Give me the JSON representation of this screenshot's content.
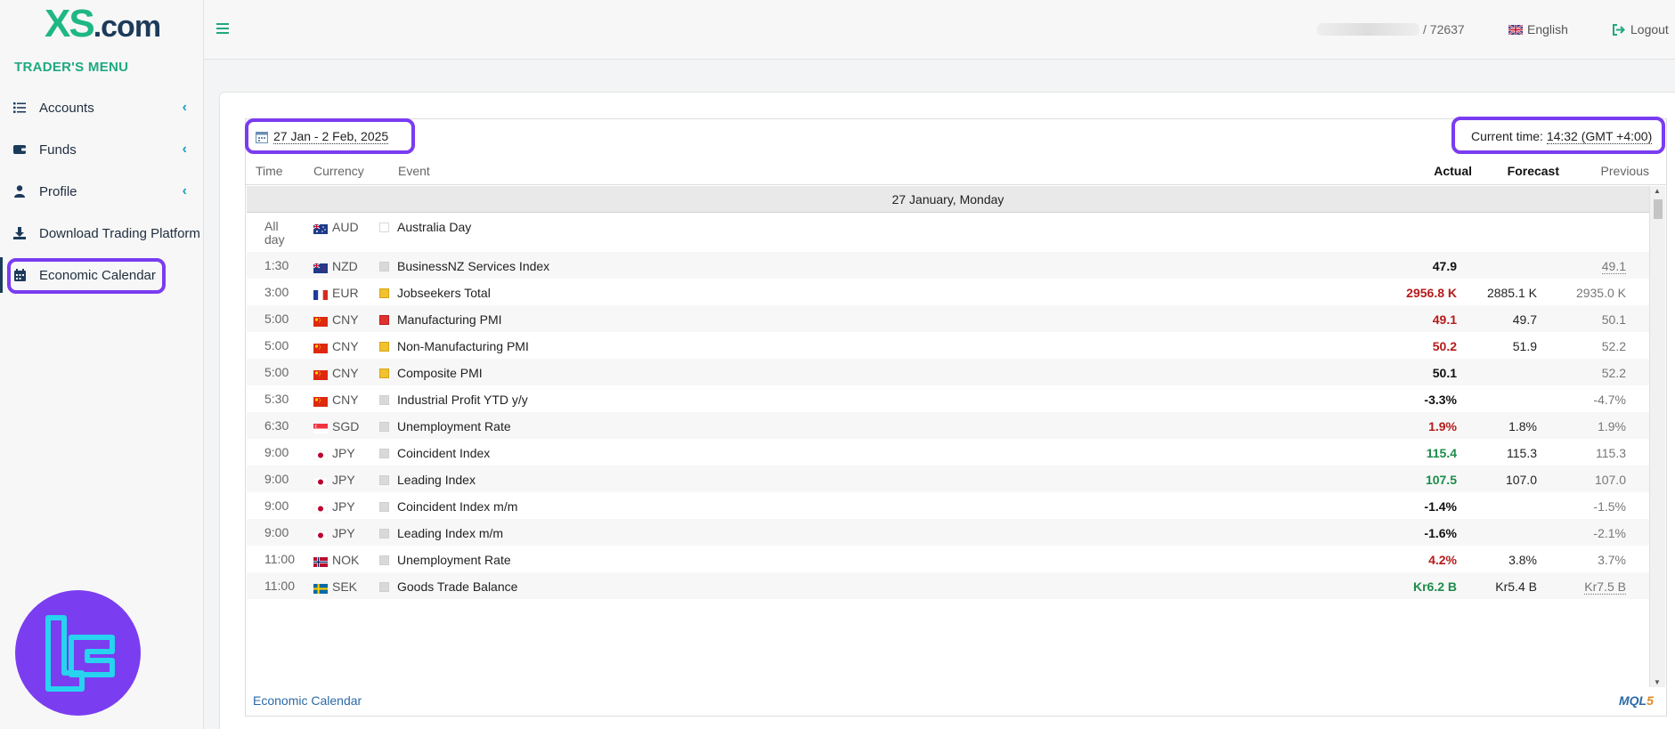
{
  "brand": {
    "logo_main": "XS",
    "logo_suffix": ".com",
    "menu_title": "TRADER'S MENU"
  },
  "sidebar": {
    "items": [
      {
        "label": "Accounts",
        "icon": "list-icon",
        "has_chevron": true
      },
      {
        "label": "Funds",
        "icon": "wallet-icon",
        "has_chevron": true
      },
      {
        "label": "Profile",
        "icon": "user-icon",
        "has_chevron": true
      },
      {
        "label": "Download Trading Platform",
        "icon": "download-icon",
        "has_chevron": false
      },
      {
        "label": "Economic Calendar",
        "icon": "calendar-icon",
        "has_chevron": false,
        "active": true
      }
    ],
    "chevron": "‹"
  },
  "topbar": {
    "account_suffix": "/ 72637",
    "language": "English",
    "logout": "Logout"
  },
  "calendar": {
    "date_range": "27 Jan - 2 Feb, 2025",
    "current_time_label": "Current time:",
    "current_time_value": "14:32 (GMT +4:00)",
    "columns": {
      "time": "Time",
      "currency": "Currency",
      "event": "Event",
      "actual": "Actual",
      "forecast": "Forecast",
      "previous": "Previous"
    },
    "day_header": "27 January, Monday",
    "rows": [
      {
        "time": "All\nday",
        "flag": "AU",
        "currency": "AUD",
        "importance": "none",
        "event": "Australia Day",
        "actual": "",
        "actual_color": "black",
        "forecast": "",
        "previous": "",
        "previous_dotted": false
      },
      {
        "time": "1:30",
        "flag": "NZ",
        "currency": "NZD",
        "importance": "low",
        "event": "BusinessNZ Services Index",
        "actual": "47.9",
        "actual_color": "black",
        "forecast": "",
        "previous": "49.1",
        "previous_dotted": true
      },
      {
        "time": "3:00",
        "flag": "FR",
        "currency": "EUR",
        "importance": "medium",
        "event": "Jobseekers Total",
        "actual": "2956.8 K",
        "actual_color": "red",
        "forecast": "2885.1 K",
        "previous": "2935.0 K",
        "previous_dotted": false
      },
      {
        "time": "5:00",
        "flag": "CN",
        "currency": "CNY",
        "importance": "high",
        "event": "Manufacturing PMI",
        "actual": "49.1",
        "actual_color": "red",
        "forecast": "49.7",
        "previous": "50.1",
        "previous_dotted": false
      },
      {
        "time": "5:00",
        "flag": "CN",
        "currency": "CNY",
        "importance": "medium",
        "event": "Non-Manufacturing PMI",
        "actual": "50.2",
        "actual_color": "red",
        "forecast": "51.9",
        "previous": "52.2",
        "previous_dotted": false
      },
      {
        "time": "5:00",
        "flag": "CN",
        "currency": "CNY",
        "importance": "medium",
        "event": "Composite PMI",
        "actual": "50.1",
        "actual_color": "black",
        "forecast": "",
        "previous": "52.2",
        "previous_dotted": false
      },
      {
        "time": "5:30",
        "flag": "CN",
        "currency": "CNY",
        "importance": "low",
        "event": "Industrial Profit YTD y/y",
        "actual": "-3.3%",
        "actual_color": "black",
        "forecast": "",
        "previous": "-4.7%",
        "previous_dotted": false
      },
      {
        "time": "6:30",
        "flag": "SG",
        "currency": "SGD",
        "importance": "low",
        "event": "Unemployment Rate",
        "actual": "1.9%",
        "actual_color": "red",
        "forecast": "1.8%",
        "previous": "1.9%",
        "previous_dotted": false
      },
      {
        "time": "9:00",
        "flag": "JP",
        "currency": "JPY",
        "importance": "low",
        "event": "Coincident Index",
        "actual": "115.4",
        "actual_color": "green",
        "forecast": "115.3",
        "previous": "115.3",
        "previous_dotted": false
      },
      {
        "time": "9:00",
        "flag": "JP",
        "currency": "JPY",
        "importance": "low",
        "event": "Leading Index",
        "actual": "107.5",
        "actual_color": "green",
        "forecast": "107.0",
        "previous": "107.0",
        "previous_dotted": false
      },
      {
        "time": "9:00",
        "flag": "JP",
        "currency": "JPY",
        "importance": "low",
        "event": "Coincident Index m/m",
        "actual": "-1.4%",
        "actual_color": "black",
        "forecast": "",
        "previous": "-1.5%",
        "previous_dotted": false
      },
      {
        "time": "9:00",
        "flag": "JP",
        "currency": "JPY",
        "importance": "low",
        "event": "Leading Index m/m",
        "actual": "-1.6%",
        "actual_color": "black",
        "forecast": "",
        "previous": "-2.1%",
        "previous_dotted": false
      },
      {
        "time": "11:00",
        "flag": "NO",
        "currency": "NOK",
        "importance": "low",
        "event": "Unemployment Rate",
        "actual": "4.2%",
        "actual_color": "red",
        "forecast": "3.8%",
        "previous": "3.7%",
        "previous_dotted": false
      },
      {
        "time": "11:00",
        "flag": "SE",
        "currency": "SEK",
        "importance": "low",
        "event": "Goods Trade Balance",
        "actual": "Kr6.2 B",
        "actual_color": "green",
        "forecast": "Kr5.4 B",
        "previous": "Kr7.5 B",
        "previous_dotted": true
      }
    ],
    "footer_link": "Economic Calendar",
    "footer_brand_main": "MQL",
    "footer_brand_num": "5"
  },
  "colors": {
    "accent": "#1fa97f",
    "highlight": "#7a3cf0",
    "badge": "#7b3df0",
    "negative": "#b51b1b",
    "positive": "#1c8c4a"
  }
}
